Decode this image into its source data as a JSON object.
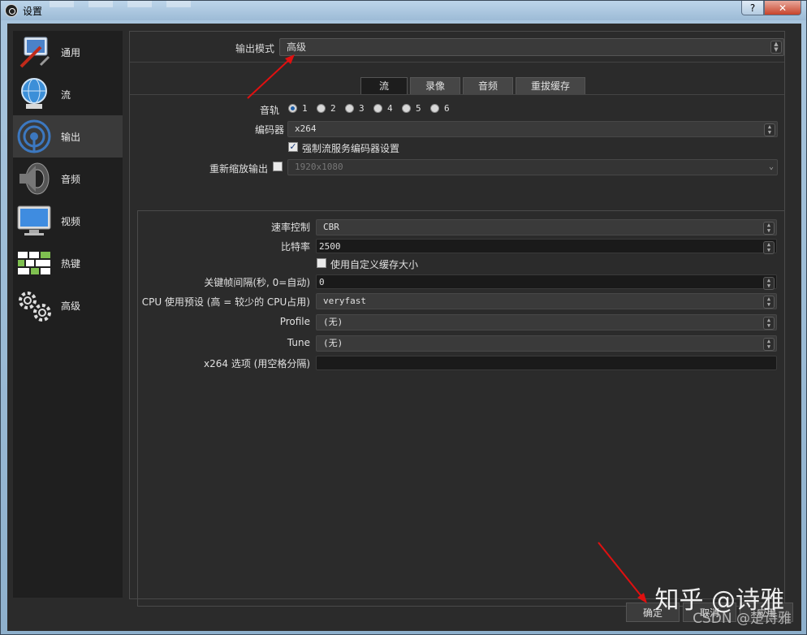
{
  "window": {
    "title": "设置",
    "help_btn": "?",
    "close_btn": "✕"
  },
  "sidebar": {
    "items": [
      {
        "label": "通用",
        "icon": "general-tools-icon"
      },
      {
        "label": "流",
        "icon": "stream-globe-icon"
      },
      {
        "label": "输出",
        "icon": "output-signal-icon",
        "active": true
      },
      {
        "label": "音频",
        "icon": "speaker-icon"
      },
      {
        "label": "视频",
        "icon": "monitor-icon"
      },
      {
        "label": "热键",
        "icon": "keyboard-icon"
      },
      {
        "label": "高级",
        "icon": "gears-icon"
      }
    ]
  },
  "output": {
    "mode_label": "输出模式",
    "mode_value": "高级",
    "tabs": [
      "流",
      "录像",
      "音频",
      "重拔缓存"
    ],
    "active_tab": "流",
    "audio_track_label": "音轨",
    "audio_tracks": [
      "1",
      "2",
      "3",
      "4",
      "5",
      "6"
    ],
    "selected_track": "1",
    "encoder_label": "编码器",
    "encoder_value": "x264",
    "enforce_label": "强制流服务编码器设置",
    "enforce_checked": true,
    "rescale_label": "重新缩放输出",
    "rescale_checked": false,
    "rescale_value": "1920x1080",
    "rate_control_label": "速率控制",
    "rate_control_value": "CBR",
    "bitrate_label": "比特率",
    "bitrate_value": "2500",
    "custom_buffer_label": "使用自定义缓存大小",
    "custom_buffer_checked": false,
    "keyframe_label": "关键帧间隔(秒, 0=自动)",
    "keyframe_value": "0",
    "cpu_preset_label": "CPU 使用预设 (高 = 较少的 CPU占用)",
    "cpu_preset_value": "veryfast",
    "profile_label": "Profile",
    "profile_value": "(无)",
    "tune_label": "Tune",
    "tune_value": "(无)",
    "x264_opts_label": "x264 选项 (用空格分隔)",
    "x264_opts_value": ""
  },
  "footer": {
    "ok": "确定",
    "cancel": "取消",
    "apply": "应用"
  },
  "watermark": {
    "main": "知乎 @诗雅",
    "sub": "CSDN @楚诗雅"
  },
  "colors": {
    "arrow": "#e01010",
    "accent": "#1f5fa8"
  }
}
